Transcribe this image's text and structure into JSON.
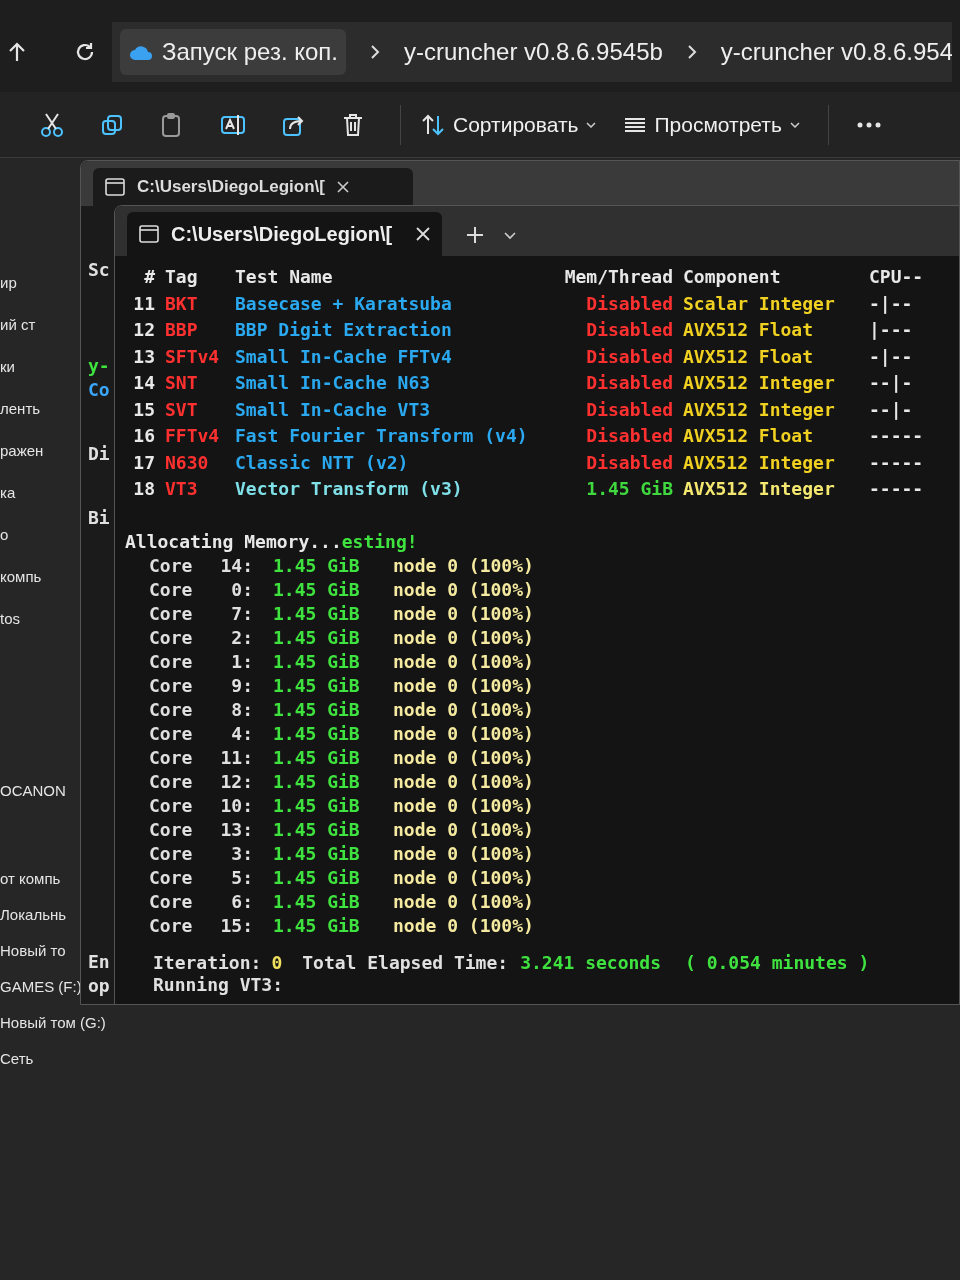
{
  "address_bar": {
    "breadcrumbs": [
      "Запуск рез. коп.",
      "y-cruncher v0.8.6.9545b",
      "y-cruncher v0.8.6.954"
    ]
  },
  "toolbar": {
    "sort_label": "Сортировать",
    "view_label": "Просмотреть"
  },
  "sidebar": {
    "groups": [
      {
        "items": [
          "ир",
          "ий ст",
          "ки",
          "ленть",
          "ражен",
          "ка",
          "о",
          "компь",
          "tos"
        ]
      },
      {
        "items": [
          "OCANON"
        ]
      },
      {
        "items": [
          "от компь",
          "Локальнь",
          "Новый то",
          "GAMES (F:)",
          "Новый том (G:)",
          "Сеть"
        ]
      }
    ]
  },
  "back_terminal": {
    "tab_title": "C:\\Users\\DiegoLegion\\[",
    "lines": [
      {
        "text": "Sc",
        "kind": "plain"
      },
      {
        "text": "y-",
        "kind": "ok"
      },
      {
        "text": "Co",
        "kind": "info"
      },
      {
        "text": "Di",
        "kind": "plain"
      },
      {
        "text": "Bi",
        "kind": "plain"
      },
      {
        "text": "En",
        "kind": "plain"
      },
      {
        "text": "op",
        "kind": "plain"
      }
    ]
  },
  "terminal": {
    "tab_title": "C:\\Users\\DiegoLegion\\[",
    "table": {
      "columns": [
        "#",
        "Tag",
        "Test Name",
        "Mem/Thread",
        "Component",
        "CPU--"
      ],
      "rows": [
        {
          "num": "11",
          "tag": "BKT",
          "name": "Basecase + Karatsuba",
          "mem": "Disabled",
          "enabled": false,
          "component": "Scalar Integer",
          "cpu": "-|--"
        },
        {
          "num": "12",
          "tag": "BBP",
          "name": "BBP Digit Extraction",
          "mem": "Disabled",
          "enabled": false,
          "component": "AVX512 Float",
          "cpu": "|---"
        },
        {
          "num": "13",
          "tag": "SFTv4",
          "name": "Small In-Cache FFTv4",
          "mem": "Disabled",
          "enabled": false,
          "component": "AVX512 Float",
          "cpu": "-|--"
        },
        {
          "num": "14",
          "tag": "SNT",
          "name": "Small In-Cache N63",
          "mem": "Disabled",
          "enabled": false,
          "component": "AVX512 Integer",
          "cpu": "--|-"
        },
        {
          "num": "15",
          "tag": "SVT",
          "name": "Small In-Cache VT3",
          "mem": "Disabled",
          "enabled": false,
          "component": "AVX512 Integer",
          "cpu": "--|-"
        },
        {
          "num": "16",
          "tag": "FFTv4",
          "name": "Fast Fourier Transform (v4)",
          "mem": "Disabled",
          "enabled": false,
          "component": "AVX512 Float",
          "cpu": "-----"
        },
        {
          "num": "17",
          "tag": "N630",
          "name": "Classic NTT (v2)",
          "mem": "Disabled",
          "enabled": false,
          "component": "AVX512 Integer",
          "cpu": "-----"
        },
        {
          "num": "18",
          "tag": "VT3",
          "name": "Vector Transform (v3)",
          "mem": "1.45 GiB",
          "enabled": true,
          "component": "AVX512 Integer",
          "cpu": "-----"
        }
      ]
    },
    "allocating": {
      "text": "Allocating Memory...",
      "status": "esting!"
    },
    "cores": [
      {
        "label": "Core",
        "index": "14:",
        "memory": "1.45 GiB",
        "node": "node 0 (100%)"
      },
      {
        "label": "Core",
        "index": "0:",
        "memory": "1.45 GiB",
        "node": "node 0 (100%)"
      },
      {
        "label": "Core",
        "index": "7:",
        "memory": "1.45 GiB",
        "node": "node 0 (100%)"
      },
      {
        "label": "Core",
        "index": "2:",
        "memory": "1.45 GiB",
        "node": "node 0 (100%)"
      },
      {
        "label": "Core",
        "index": "1:",
        "memory": "1.45 GiB",
        "node": "node 0 (100%)"
      },
      {
        "label": "Core",
        "index": "9:",
        "memory": "1.45 GiB",
        "node": "node 0 (100%)"
      },
      {
        "label": "Core",
        "index": "8:",
        "memory": "1.45 GiB",
        "node": "node 0 (100%)"
      },
      {
        "label": "Core",
        "index": "4:",
        "memory": "1.45 GiB",
        "node": "node 0 (100%)"
      },
      {
        "label": "Core",
        "index": "11:",
        "memory": "1.45 GiB",
        "node": "node 0 (100%)"
      },
      {
        "label": "Core",
        "index": "12:",
        "memory": "1.45 GiB",
        "node": "node 0 (100%)"
      },
      {
        "label": "Core",
        "index": "10:",
        "memory": "1.45 GiB",
        "node": "node 0 (100%)"
      },
      {
        "label": "Core",
        "index": "13:",
        "memory": "1.45 GiB",
        "node": "node 0 (100%)"
      },
      {
        "label": "Core",
        "index": "3:",
        "memory": "1.45 GiB",
        "node": "node 0 (100%)"
      },
      {
        "label": "Core",
        "index": "5:",
        "memory": "1.45 GiB",
        "node": "node 0 (100%)"
      },
      {
        "label": "Core",
        "index": "6:",
        "memory": "1.45 GiB",
        "node": "node 0 (100%)"
      },
      {
        "label": "Core",
        "index": "15:",
        "memory": "1.45 GiB",
        "node": "node 0 (100%)"
      }
    ],
    "iteration": {
      "label": "Iteration:",
      "value": "0",
      "elapsed_label": "Total Elapsed Time:",
      "elapsed": "3.241 seconds",
      "minutes": "( 0.054 minutes )"
    },
    "running": "Running VT3:"
  }
}
